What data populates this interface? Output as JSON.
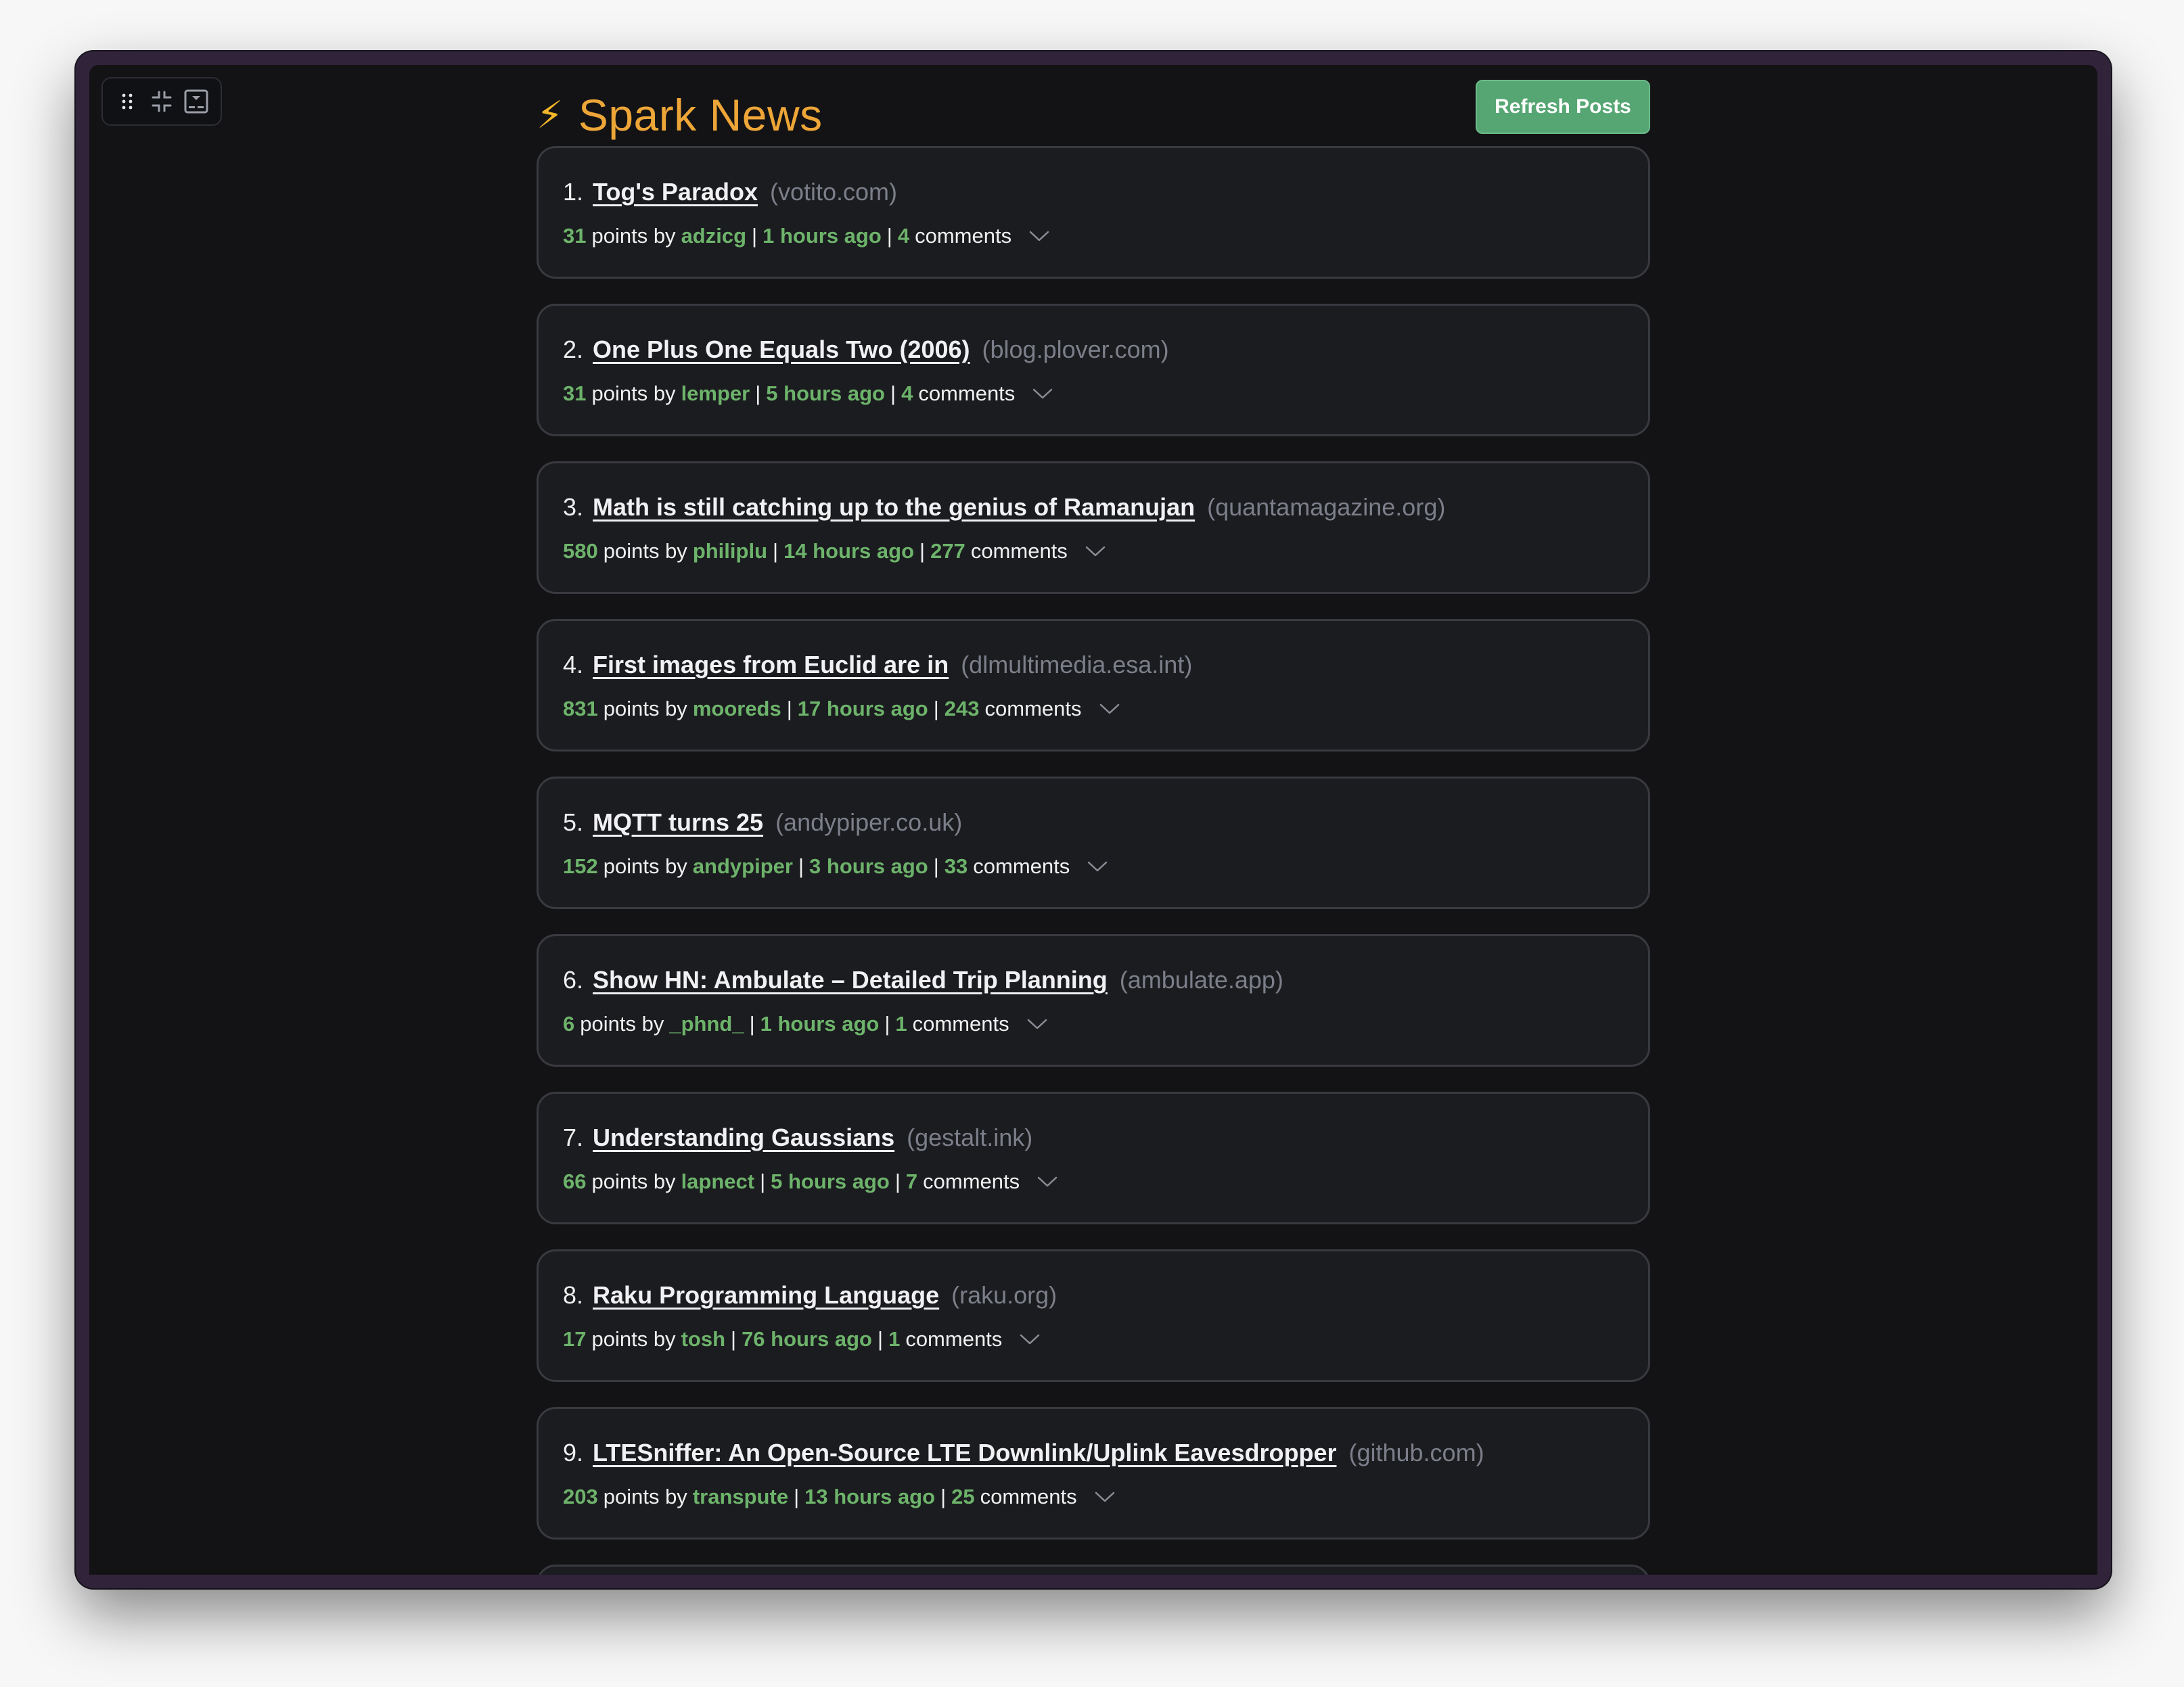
{
  "toolbar": {
    "icons": [
      "drag-handle-icon",
      "collapse-icon",
      "panel-toggle-icon"
    ]
  },
  "header": {
    "icon": "lightning-bolt-icon",
    "bolt_glyph": "⚡",
    "title": "Spark News",
    "refresh_label": "Refresh Posts"
  },
  "colors": {
    "accent_title": "#eda637",
    "button": "#56a673",
    "meta_green": "#6db36b",
    "domain_gray": "#7c7f8a",
    "frame": "#30233a",
    "background": "#131315",
    "card": "#1b1c1f"
  },
  "labels": {
    "points": "points by",
    "comments": "comments",
    "pipe": "|"
  },
  "posts": [
    {
      "rank": "1.",
      "title": "Tog's Paradox",
      "domain": "(votito.com)",
      "points": "31",
      "author": "adzicg",
      "time": "1 hours ago",
      "comments": "4"
    },
    {
      "rank": "2.",
      "title": "One Plus One Equals Two (2006)",
      "domain": "(blog.plover.com)",
      "points": "31",
      "author": "lemper",
      "time": "5 hours ago",
      "comments": "4"
    },
    {
      "rank": "3.",
      "title": "Math is still catching up to the genius of Ramanujan",
      "domain": "(quantamagazine.org)",
      "points": "580",
      "author": "philiplu",
      "time": "14 hours ago",
      "comments": "277"
    },
    {
      "rank": "4.",
      "title": "First images from Euclid are in",
      "domain": "(dlmultimedia.esa.int)",
      "points": "831",
      "author": "mooreds",
      "time": "17 hours ago",
      "comments": "243"
    },
    {
      "rank": "5.",
      "title": "MQTT turns 25",
      "domain": "(andypiper.co.uk)",
      "points": "152",
      "author": "andypiper",
      "time": "3 hours ago",
      "comments": "33"
    },
    {
      "rank": "6.",
      "title": "Show HN: Ambulate – Detailed Trip Planning",
      "domain": "(ambulate.app)",
      "points": "6",
      "author": "_phnd_",
      "time": "1 hours ago",
      "comments": "1"
    },
    {
      "rank": "7.",
      "title": "Understanding Gaussians",
      "domain": "(gestalt.ink)",
      "points": "66",
      "author": "lapnect",
      "time": "5 hours ago",
      "comments": "7"
    },
    {
      "rank": "8.",
      "title": "Raku Programming Language",
      "domain": "(raku.org)",
      "points": "17",
      "author": "tosh",
      "time": "76 hours ago",
      "comments": "1"
    },
    {
      "rank": "9.",
      "title": "LTESniffer: An Open-Source LTE Downlink/Uplink Eavesdropper",
      "domain": "(github.com)",
      "points": "203",
      "author": "transpute",
      "time": "13 hours ago",
      "comments": "25"
    }
  ]
}
